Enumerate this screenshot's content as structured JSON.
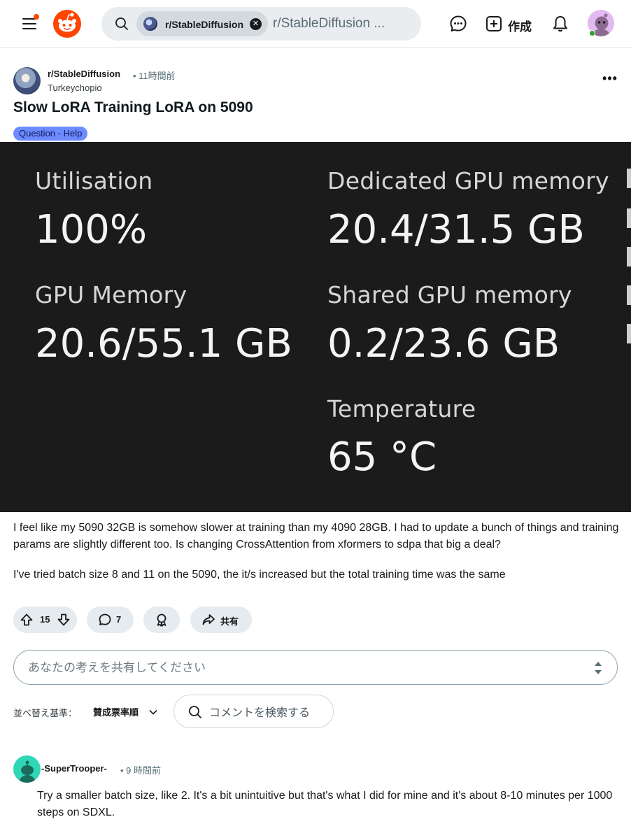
{
  "header": {
    "search": {
      "chip_label": "r/StableDiffusion",
      "placeholder": "r/StableDiffusion ..."
    },
    "create_label": "作成"
  },
  "post": {
    "subreddit": "r/StableDiffusion",
    "time": "• 11時間前",
    "author": "Turkeychopio",
    "title": "Slow LoRA Training LoRA on 5090",
    "flair": "Question - Help",
    "image": {
      "stats": [
        {
          "label": "Utilisation",
          "value": "100%"
        },
        {
          "label": "Dedicated GPU memory",
          "value": "20.4/31.5 GB"
        },
        {
          "label": "GPU Memory",
          "value": "20.6/55.1 GB"
        },
        {
          "label": "Shared GPU memory",
          "value": "0.2/23.6 GB"
        },
        {
          "label": "Temperature",
          "value": "65 °C"
        }
      ]
    },
    "body": [
      "I feel like my 5090 32GB is somehow slower at training than my 4090 28GB. I had to update a bunch of things and training params are slightly different too. Is changing CrossAttention from xformers to sdpa that big a deal?",
      "I've tried batch size 8 and 11 on the 5090, the it/s increased but the total training time was the same"
    ],
    "actions": {
      "votes": "15",
      "comments": "7",
      "share_label": "共有"
    }
  },
  "composer": {
    "placeholder": "あなたの考えを共有してください"
  },
  "sort": {
    "label": "並べ替え基準：",
    "selected": "賛成票率順",
    "search_placeholder": "コメントを検索する"
  },
  "comments": [
    {
      "author": "-SuperTrooper-",
      "time": "• 9 時間前",
      "text": "Try a smaller batch size, like 2. It's a bit unintuitive but that's what I did for mine and it's about 8-10 minutes per 1000 steps on SDXL."
    }
  ],
  "colors": {
    "accent": "#ff4500",
    "flair_bg": "#6d8bff",
    "action_bg": "#e5ebee",
    "image_bg": "#1b1b1b"
  }
}
